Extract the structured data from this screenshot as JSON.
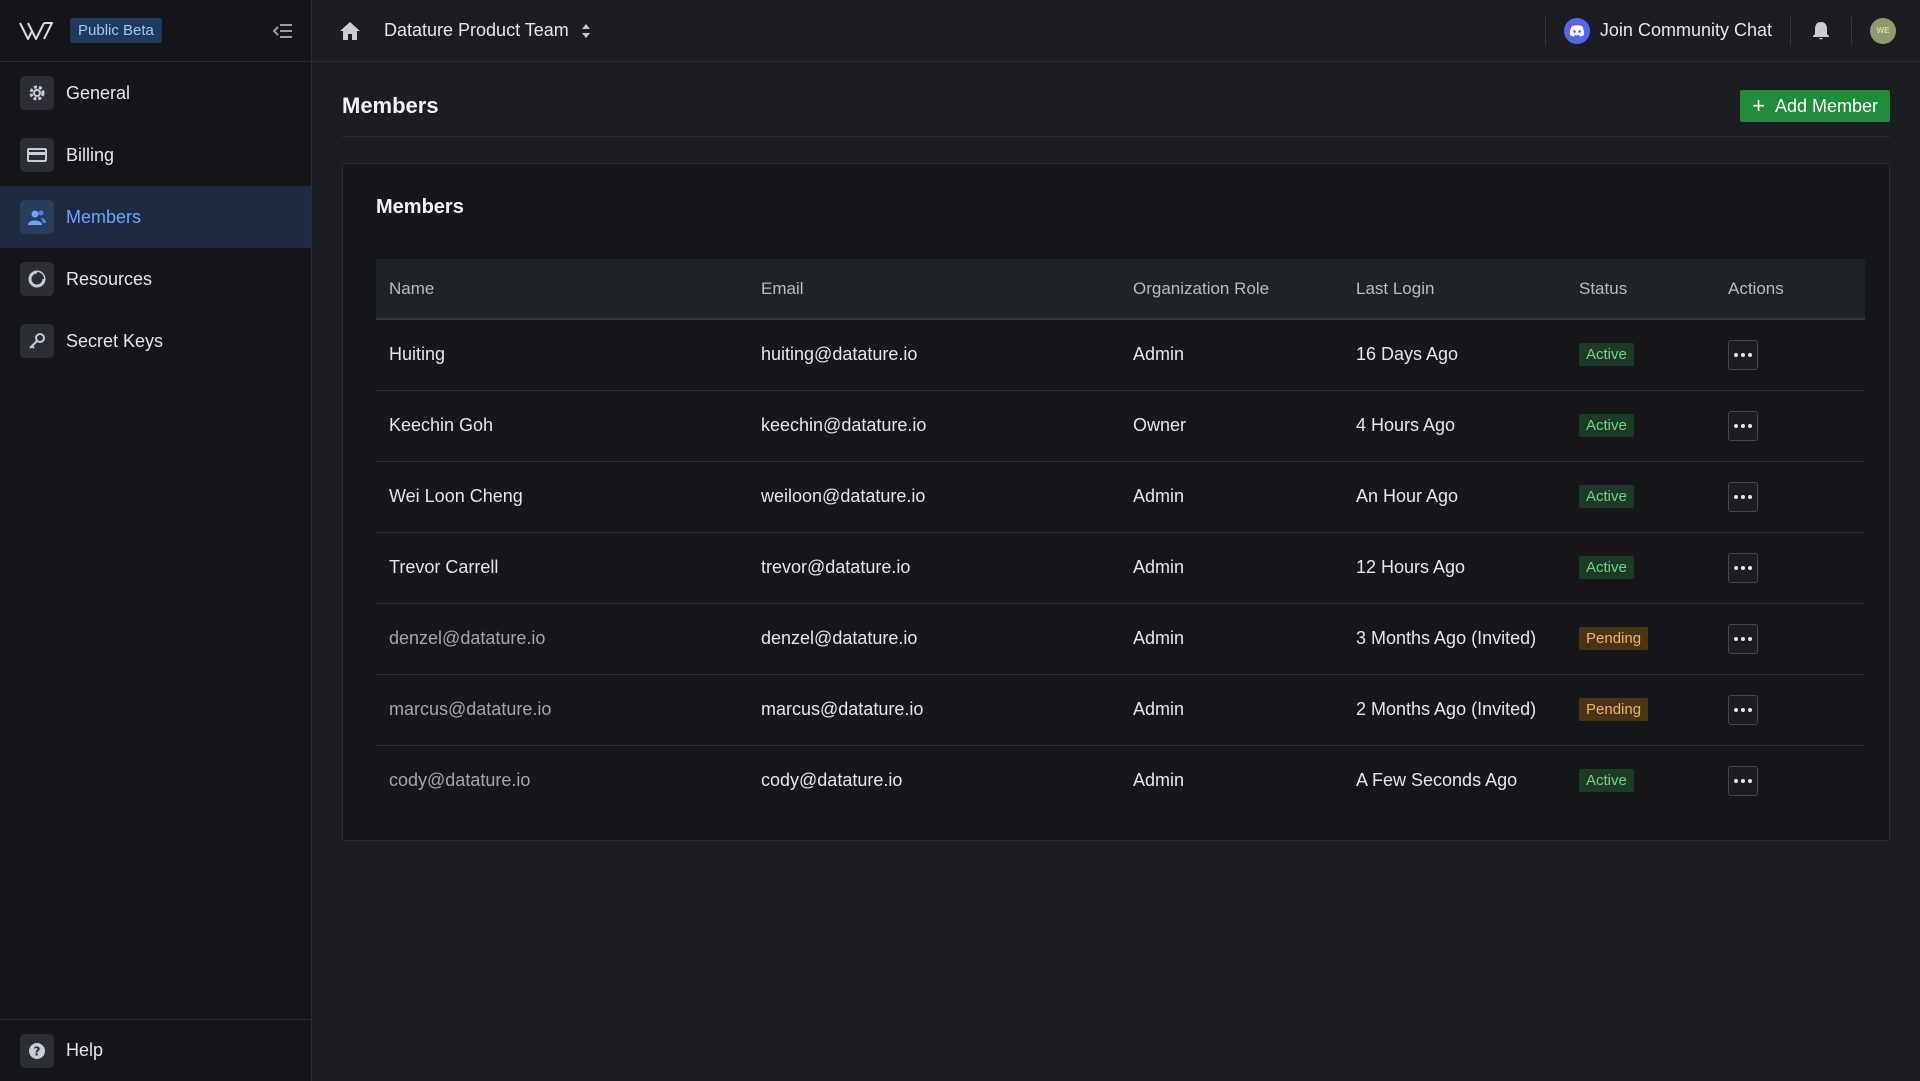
{
  "sidebar": {
    "beta_label": "Public Beta",
    "items": [
      {
        "label": "General",
        "icon": "gear-icon"
      },
      {
        "label": "Billing",
        "icon": "credit-card-icon"
      },
      {
        "label": "Members",
        "icon": "users-icon",
        "active": true
      },
      {
        "label": "Resources",
        "icon": "pie-chart-icon"
      },
      {
        "label": "Secret Keys",
        "icon": "key-icon"
      }
    ],
    "help_label": "Help"
  },
  "topbar": {
    "team_name": "Datature Product Team",
    "community_label": "Join Community Chat",
    "avatar_initials": "WE"
  },
  "page": {
    "title": "Members",
    "add_button_label": "Add Member",
    "card_title": "Members"
  },
  "table": {
    "columns": [
      "Name",
      "Email",
      "Organization Role",
      "Last Login",
      "Status",
      "Actions"
    ],
    "rows": [
      {
        "name": "Huiting",
        "email": "huiting@datature.io",
        "role": "Admin",
        "last_login": "16 Days Ago",
        "status": "Active"
      },
      {
        "name": "Keechin Goh",
        "email": "keechin@datature.io",
        "role": "Owner",
        "last_login": "4 Hours Ago",
        "status": "Active"
      },
      {
        "name": "Wei Loon Cheng",
        "email": "weiloon@datature.io",
        "role": "Admin",
        "last_login": "An Hour Ago",
        "status": "Active"
      },
      {
        "name": "Trevor Carrell",
        "email": "trevor@datature.io",
        "role": "Admin",
        "last_login": "12 Hours Ago",
        "status": "Active"
      },
      {
        "name": "denzel@datature.io",
        "email": "denzel@datature.io",
        "role": "Admin",
        "last_login": "3 Months Ago (Invited)",
        "status": "Pending"
      },
      {
        "name": "marcus@datature.io",
        "email": "marcus@datature.io",
        "role": "Admin",
        "last_login": "2 Months Ago (Invited)",
        "status": "Pending"
      },
      {
        "name": "cody@datature.io",
        "email": "cody@datature.io",
        "role": "Admin",
        "last_login": "A Few Seconds Ago",
        "status": "Active"
      }
    ]
  },
  "colors": {
    "accent": "#6aa7ff",
    "add_button": "#1f8b3b",
    "active_status": "#6fd48b",
    "pending_status": "#f3b25f"
  }
}
